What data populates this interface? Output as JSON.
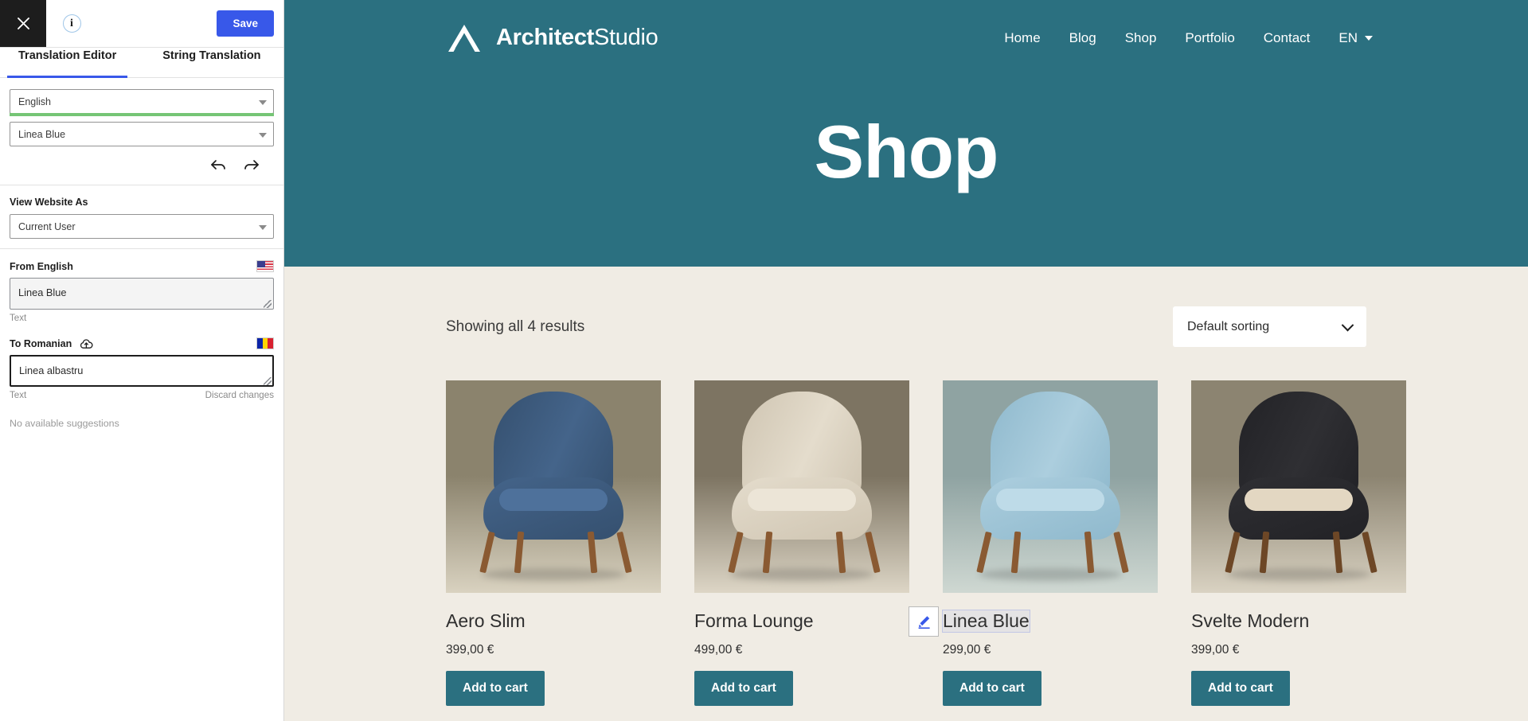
{
  "sidebar": {
    "close_label": "Close",
    "info_label": "i",
    "save_label": "Save",
    "tabs": [
      {
        "label": "Translation Editor",
        "active": true
      },
      {
        "label": "String Translation",
        "active": false
      }
    ],
    "language_select": {
      "value": "English"
    },
    "string_select": {
      "value": "Linea Blue"
    },
    "view_website_as": {
      "label": "View Website As",
      "value": "Current User"
    },
    "source": {
      "label": "From English",
      "flag": "us-flag-icon",
      "value": "Linea Blue",
      "meta": "Text"
    },
    "target": {
      "label": "To Romanian",
      "flag": "romania-flag-icon",
      "cloud_icon": "cloud-upload-icon",
      "value": "Linea albastru",
      "meta": "Text",
      "discard_label": "Discard changes",
      "suggestions": "No available suggestions"
    },
    "undo_icon": "undo-icon",
    "redo_icon": "redo-icon"
  },
  "site": {
    "brand": {
      "bold": "Architect",
      "light": "Studio",
      "logo": "architect-a-logo"
    },
    "nav": [
      {
        "label": "Home"
      },
      {
        "label": "Blog"
      },
      {
        "label": "Shop"
      },
      {
        "label": "Portfolio"
      },
      {
        "label": "Contact"
      }
    ],
    "language": {
      "label": "EN"
    },
    "hero_title": "Shop",
    "results_count": "Showing all 4 results",
    "sorting": {
      "value": "Default sorting"
    },
    "products": [
      {
        "name": "Aero Slim",
        "price": "399,00 €",
        "add_label": "Add to cart",
        "highlighted": false,
        "colors": {
          "body": "#44648a",
          "shade": "#35506f",
          "cushion": "#4e719b",
          "bg_top": "#8b836d",
          "bg_bottom": "#d9d2c0",
          "leg": "#8a5a32"
        }
      },
      {
        "name": "Forma Lounge",
        "price": "499,00 €",
        "add_label": "Add to cart",
        "highlighted": false,
        "colors": {
          "body": "#e4dccc",
          "shade": "#cfc5b2",
          "cushion": "#ece5d7",
          "bg_top": "#7d7462",
          "bg_bottom": "#ddd6c6",
          "leg": "#8a5a32"
        }
      },
      {
        "name": "Linea Blue",
        "price": "299,00 €",
        "add_label": "Add to cart",
        "highlighted": true,
        "edit_icon": "pencil-edit-icon",
        "colors": {
          "body": "#accede",
          "shade": "#8fb9cd",
          "cushion": "#bedbe8",
          "bg_top": "#8fa3a2",
          "bg_bottom": "#cfd8d2",
          "leg": "#8a5a32"
        }
      },
      {
        "name": "Svelte Modern",
        "price": "399,00 €",
        "add_label": "Add to cart",
        "highlighted": false,
        "colors": {
          "body": "#2f2f33",
          "shade": "#222226",
          "cushion": "#e3d7c2",
          "bg_top": "#8c8471",
          "bg_bottom": "#d9d2c2",
          "leg": "#6d4726"
        }
      }
    ]
  },
  "theme": {
    "teal": "#2b7080",
    "page_bg": "#f0ece4",
    "accent_blue": "#3858e9",
    "green": "#76c576"
  }
}
